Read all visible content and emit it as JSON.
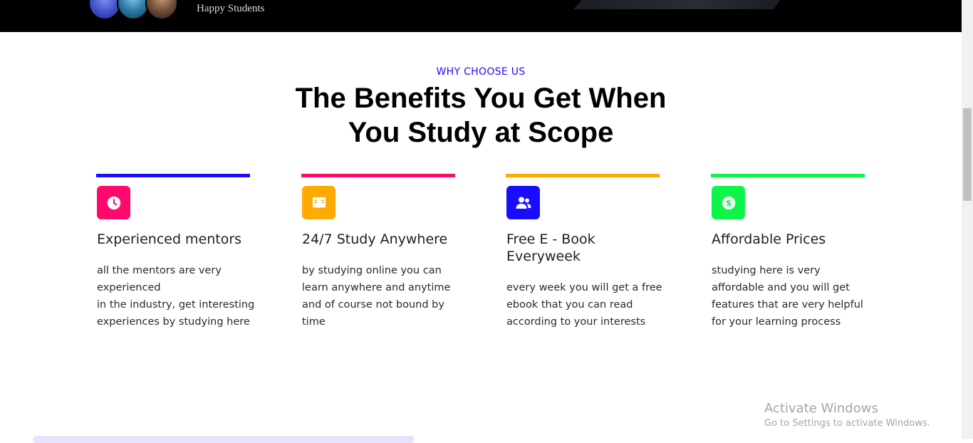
{
  "hero": {
    "happy_students_label": "Happy Students"
  },
  "section": {
    "eyebrow": "WHY CHOOSE US",
    "heading_line1": "The Benefits You Get When",
    "heading_line2": "You Study at Scope"
  },
  "features": [
    {
      "title": "Experienced mentors",
      "description": "all the mentors are very experienced\nin the industry, get interesting experiences by studying here",
      "accent": "#1a0dff",
      "icon_bg": "#ff0a6c",
      "icon": "clock-icon"
    },
    {
      "title": "24/7 Study Anywhere",
      "description": "by studying online you can learn anywhere and anytime and of course not bound by time",
      "accent": "#ff0a6c",
      "icon_bg": "#ffaa00",
      "icon": "book-icon"
    },
    {
      "title": "Free E - Book Everyweek",
      "description": "every week you will get a free ebook that you can read according to your interests",
      "accent": "#ffaa00",
      "icon_bg": "#1a0dff",
      "icon": "users-icon"
    },
    {
      "title": "Affordable Prices",
      "description": "studying here is very affordable and you will get features that are very helpful for your learning process",
      "accent": "#0ef54a",
      "icon_bg": "#0ef54a",
      "icon": "dollar-icon"
    }
  ],
  "watermark": {
    "line1": "Activate Windows",
    "line2": "Go to Settings to activate Windows."
  }
}
